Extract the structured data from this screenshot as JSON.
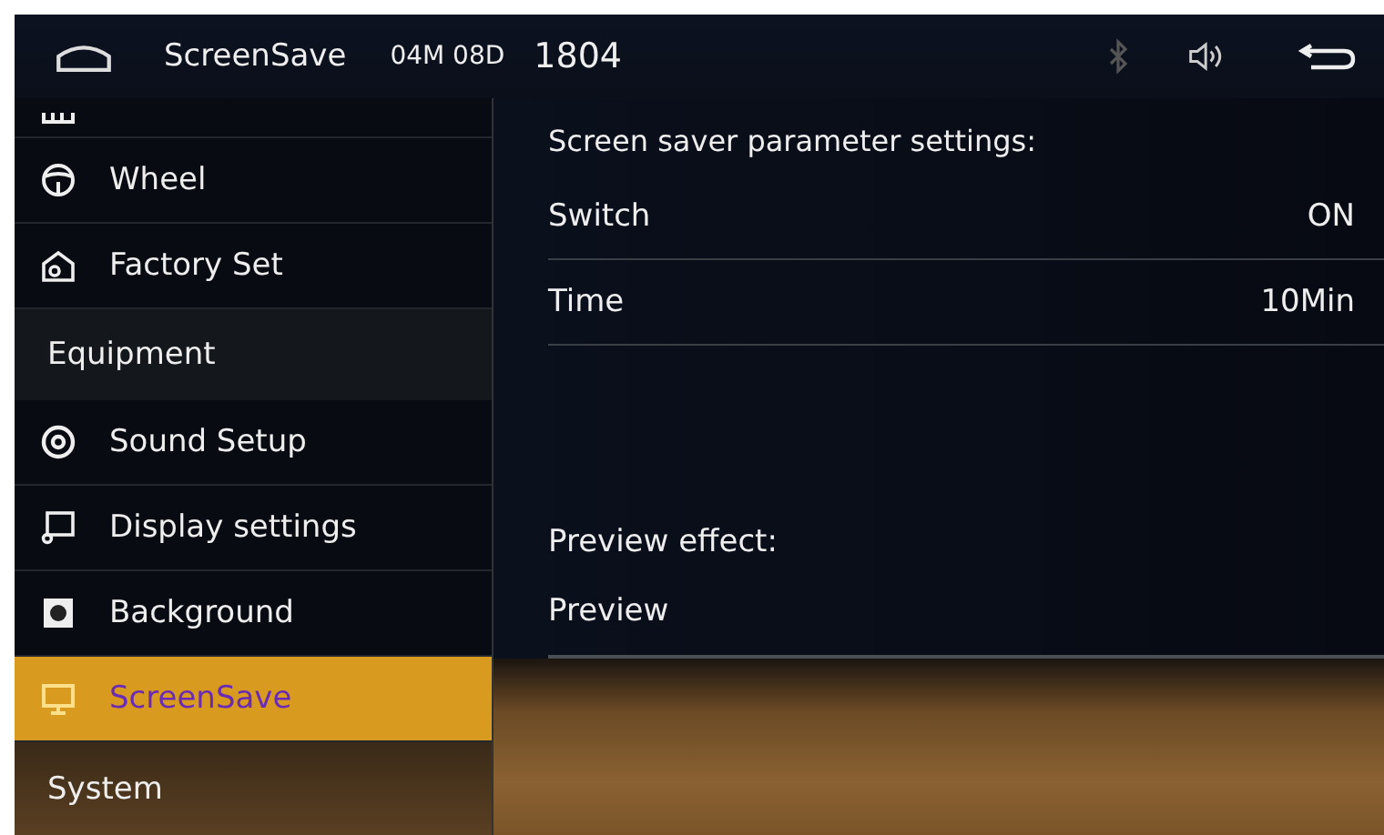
{
  "header": {
    "title": "ScreenSave",
    "date": "04M 08D",
    "time": "1804"
  },
  "sidebar": {
    "items": [
      {
        "kind": "partial"
      },
      {
        "kind": "item",
        "label": "Wheel",
        "selected": false
      },
      {
        "kind": "item",
        "label": "Factory Set",
        "selected": false
      },
      {
        "kind": "header",
        "label": "Equipment"
      },
      {
        "kind": "item",
        "label": "Sound Setup",
        "selected": false
      },
      {
        "kind": "item",
        "label": "Display settings",
        "selected": false
      },
      {
        "kind": "item",
        "label": "Background",
        "selected": false
      },
      {
        "kind": "item",
        "label": "ScreenSave",
        "selected": true
      },
      {
        "kind": "header",
        "label": "System"
      }
    ]
  },
  "panel": {
    "heading": "Screen saver parameter settings:",
    "rows": [
      {
        "label": "Switch",
        "value": "ON"
      },
      {
        "label": "Time",
        "value": "10Min"
      }
    ],
    "preview_heading": "Preview effect:",
    "preview_label": "Preview"
  }
}
